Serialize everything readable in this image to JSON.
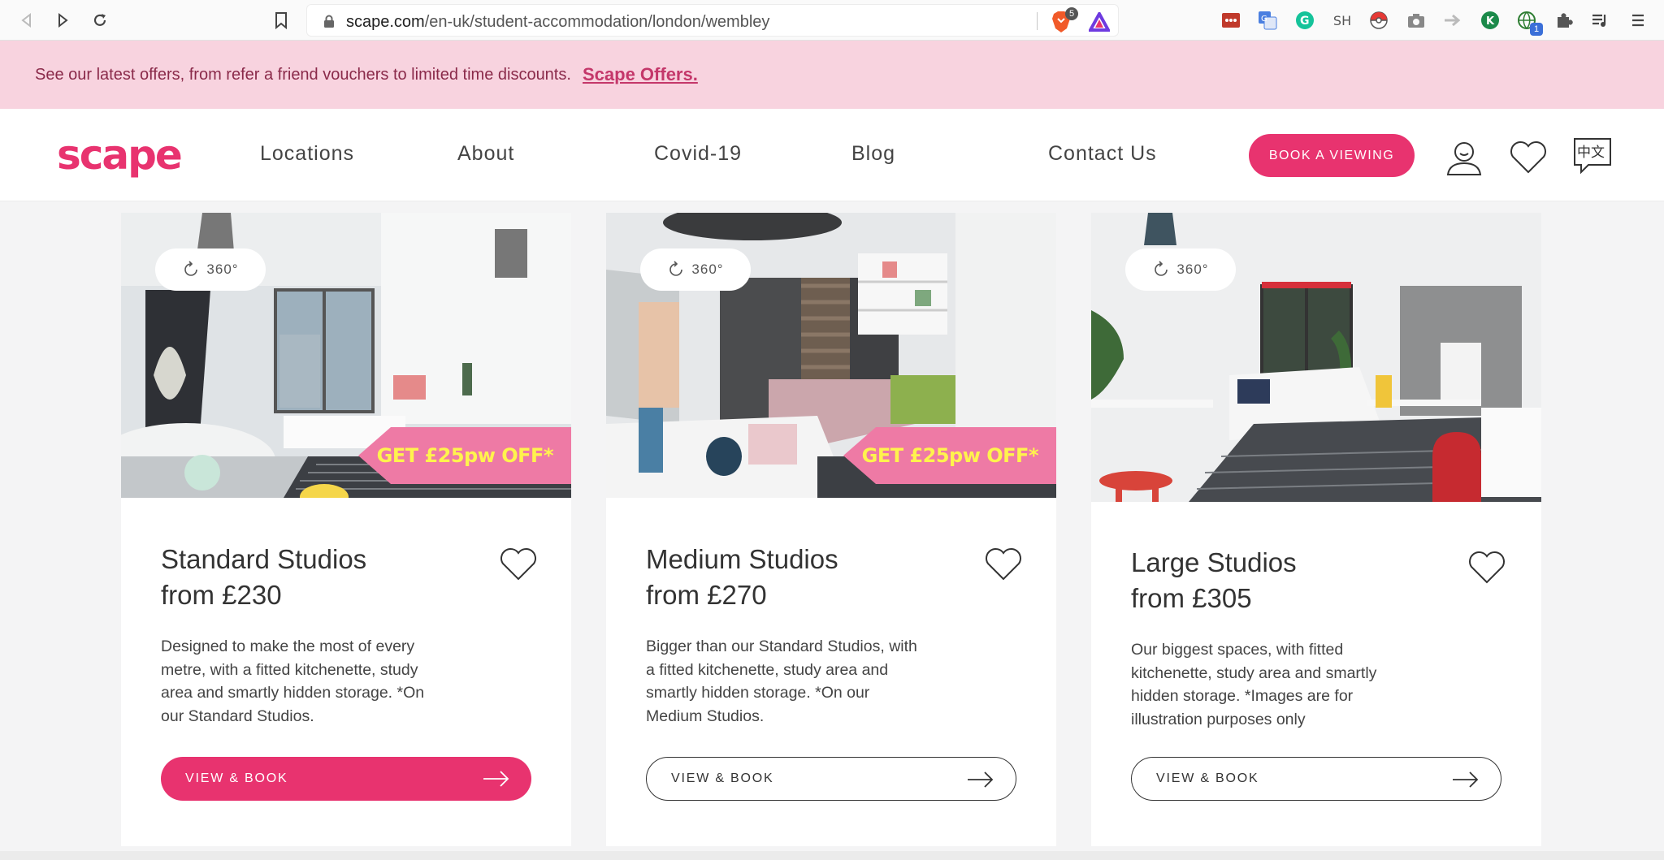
{
  "browser": {
    "url_host": "scape.com",
    "url_path": "/en-uk/student-accommodation/london/wembley",
    "brave_badge": "5",
    "ext_sh": "SH",
    "ext_badge": "1"
  },
  "promo": {
    "text": "See our latest offers, from refer a friend vouchers to limited time discounts.",
    "link": "Scape Offers."
  },
  "header": {
    "logo": "scape",
    "nav": [
      "Locations",
      "About",
      "Covid-19",
      "Blog",
      "Contact Us"
    ],
    "cta": "BOOK A VIEWING",
    "lang": "中文"
  },
  "colors": {
    "brand": "#e8336f",
    "promo_bg": "#f8d3df",
    "offer_bg": "#ee7aa5",
    "offer_text": "#fff34d"
  },
  "cards": [
    {
      "badge": "360°",
      "offer": "GET £25pw OFF*",
      "title_line1": "Standard Studios",
      "title_line2": "from £230",
      "description": "Designed to make the most of every metre, with a fitted kitchenette, study area and smartly hidden storage. *On our Standard Studios.",
      "button": "VIEW & BOOK"
    },
    {
      "badge": "360°",
      "offer": "GET £25pw OFF*",
      "title_line1": "Medium Studios",
      "title_line2": "from £270",
      "description": "Bigger than our Standard Studios, with a fitted kitchenette, study area and smartly hidden storage. *On our Medium Studios.",
      "button": "VIEW & BOOK"
    },
    {
      "badge": "360°",
      "title_line1": "Large Studios",
      "title_line2": "from £305",
      "description": "Our biggest spaces, with fitted kitchenette, study area and smartly hidden storage. *Images are for illustration purposes only",
      "button": "VIEW & BOOK"
    }
  ]
}
